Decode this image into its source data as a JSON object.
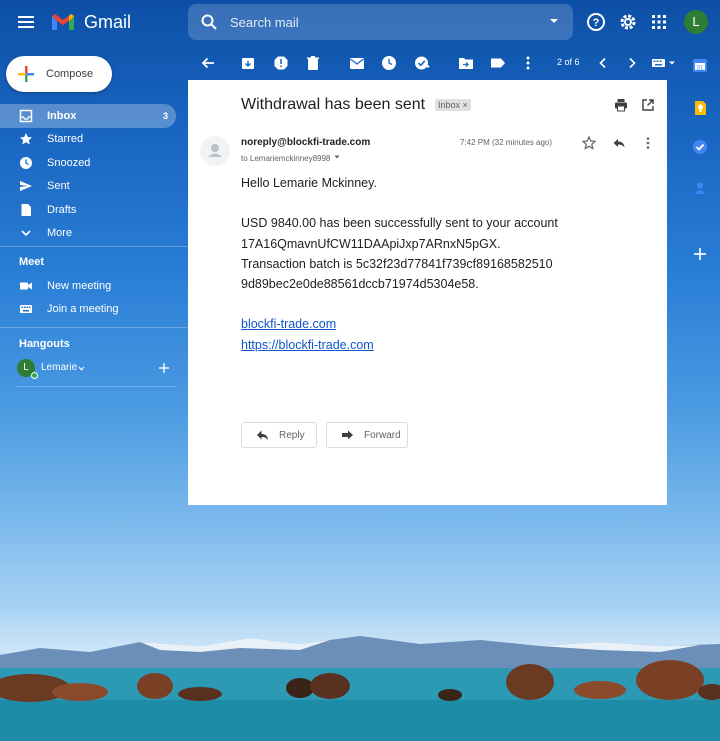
{
  "header": {
    "app_name": "Gmail",
    "search_placeholder": "Search mail",
    "avatar_initial": "L"
  },
  "compose": {
    "label": "Compose"
  },
  "nav": {
    "items": [
      {
        "label": "Inbox",
        "count": "3",
        "icon": "inbox-icon"
      },
      {
        "label": "Starred",
        "icon": "star-icon"
      },
      {
        "label": "Snoozed",
        "icon": "clock-icon"
      },
      {
        "label": "Sent",
        "icon": "send-icon"
      },
      {
        "label": "Drafts",
        "icon": "draft-icon"
      },
      {
        "label": "More",
        "icon": "chevron-down-icon"
      }
    ]
  },
  "meet": {
    "title": "Meet",
    "items": [
      {
        "label": "New meeting",
        "icon": "video-icon"
      },
      {
        "label": "Join a meeting",
        "icon": "keyboard-icon"
      }
    ]
  },
  "hangouts": {
    "title": "Hangouts",
    "user_initial": "L",
    "user_name": "Lemarie"
  },
  "toolbar": {
    "page_info": "2 of 6"
  },
  "email": {
    "subject": "Withdrawal has been sent",
    "label_badge": "Inbox",
    "sender": "noreply@blockfi-trade.com",
    "to": "to Lemariemckinney8998",
    "time": "7:42 PM (32 minutes ago)",
    "greeting": "Hello Lemarie Mckinney.",
    "line1": "USD 9840.00 has been successfully sent to your  account",
    "line2": "17A16QmavnUfCW11DAApiJxp7ARnxN5pGX.",
    "line3": "Transaction batch is 5c32f23d77841f739cf89168582510",
    "line4": "9d89bec2e0de88561dccb71974d5304e58.",
    "link1": "blockfi-trade.com",
    "link2": "https://blockfi-trade.com",
    "reply_label": "Reply",
    "forward_label": "Forward"
  },
  "colors": {
    "accent": "#1a73e8",
    "link": "#1155cc",
    "avatar": "#2e7d32"
  }
}
